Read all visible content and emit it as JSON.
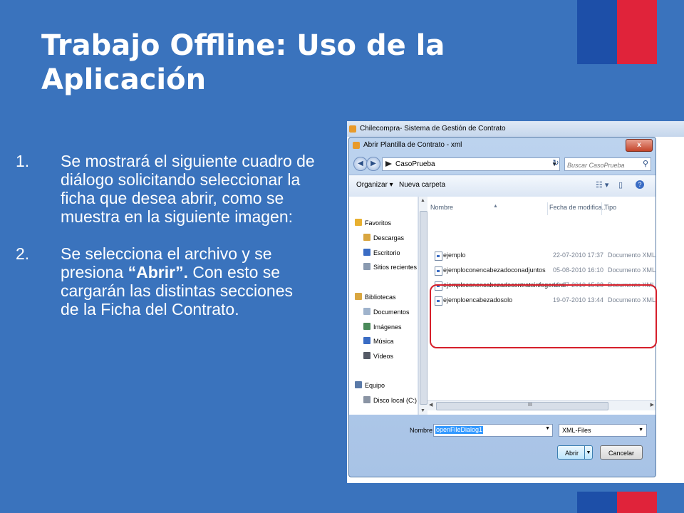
{
  "slide": {
    "title": "Trabajo Offline: Uso de la Aplicación",
    "bullets": [
      {
        "num": "1.",
        "text": "Se mostrará el siguiente cuadro de diálogo solicitando seleccionar la ficha que desea abrir, como se muestra en la siguiente imagen:"
      },
      {
        "num": "2.",
        "text_before": "Se selecciona el archivo y se presiona ",
        "bold": "“Abrir”.",
        "text_after": " Con esto se cargarán las distintas secciones de la Ficha del Contrato."
      }
    ]
  },
  "screenshot": {
    "app_title": "Chilecompra- Sistema de Gestión de Contrato",
    "dialog_title": "Abrir Plantilla de Contrato - xml",
    "close_label": "x",
    "address": "CasoPrueba",
    "search_placeholder": "Buscar CasoPrueba",
    "toolbar": {
      "organize": "Organizar ▾",
      "new_folder": "Nueva carpeta"
    },
    "nav": [
      {
        "label": "Favoritos",
        "icon": "star-icon",
        "color": "#e8b030",
        "level": 0
      },
      {
        "label": "Descargas",
        "icon": "download-folder-icon",
        "color": "#d9a640",
        "level": 1
      },
      {
        "label": "Escritorio",
        "icon": "desktop-icon",
        "color": "#3a6cc4",
        "level": 1
      },
      {
        "label": "Sitios recientes",
        "icon": "recent-places-icon",
        "color": "#8a9ab0",
        "level": 1
      },
      {
        "label": "Bibliotecas",
        "icon": "library-icon",
        "color": "#d9a640",
        "level": 0
      },
      {
        "label": "Documentos",
        "icon": "documents-icon",
        "color": "#9fb3cc",
        "level": 1
      },
      {
        "label": "Imágenes",
        "icon": "pictures-icon",
        "color": "#4a8a5a",
        "level": 1
      },
      {
        "label": "Música",
        "icon": "music-icon",
        "color": "#3a6cc4",
        "level": 1
      },
      {
        "label": "Vídeos",
        "icon": "videos-icon",
        "color": "#555a66",
        "level": 1
      },
      {
        "label": "Equipo",
        "icon": "computer-icon",
        "color": "#5a7aa8",
        "level": 0
      },
      {
        "label": "Disco local (C:)",
        "icon": "disk-icon",
        "color": "#8a94a4",
        "level": 1
      }
    ],
    "columns": {
      "name": "Nombre",
      "date": "Fecha de modifica...",
      "type": "Tipo"
    },
    "files": [
      {
        "name": "ejemplo",
        "date": "22-07-2010 17:37",
        "type": "Documento XML"
      },
      {
        "name": "ejemploconencabezadoconadjuntos",
        "date": "05-08-2010 16:10",
        "type": "Documento XML"
      },
      {
        "name": "ejemploconencabezadocontratoinfogeneral",
        "date": "19-07-2010 15:28",
        "type": "Documento XML"
      },
      {
        "name": "ejemploencabezadosolo",
        "date": "19-07-2010 13:44",
        "type": "Documento XML"
      }
    ],
    "filename_label": "Nombre:",
    "filename_value": "openFileDialog1",
    "filetype": "XML-Files",
    "open_label": "Abrir",
    "cancel_label": "Cancelar",
    "hscroll_grip": "III"
  },
  "colors": {
    "background": "#3a73bd",
    "flag_blue": "#1d4fa8",
    "flag_red": "#e0233a",
    "highlight": "#d61f2a"
  }
}
